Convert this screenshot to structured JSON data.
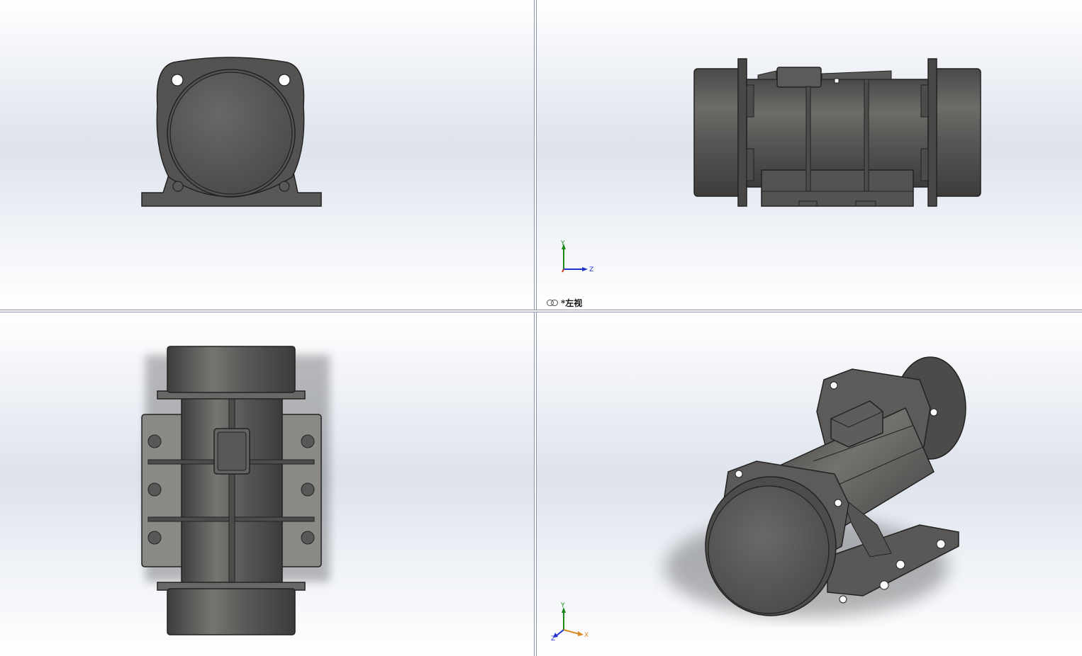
{
  "viewports": {
    "top_left": {
      "name": "front-view"
    },
    "top_right": {
      "name": "left-view",
      "label": "*左视",
      "triad_axes": [
        "Y",
        "Z"
      ]
    },
    "bottom_left": {
      "name": "top-view"
    },
    "bottom_right": {
      "name": "isometric-view",
      "triad_axes": [
        "Y",
        "X",
        "Z"
      ]
    }
  },
  "colors": {
    "metal": "#5d5b59",
    "metal_dark": "#3a3938",
    "metal_light": "#8b8986",
    "axis_x": "#d63a1a",
    "axis_y": "#1b8a1b",
    "axis_z": "#2233cc"
  }
}
